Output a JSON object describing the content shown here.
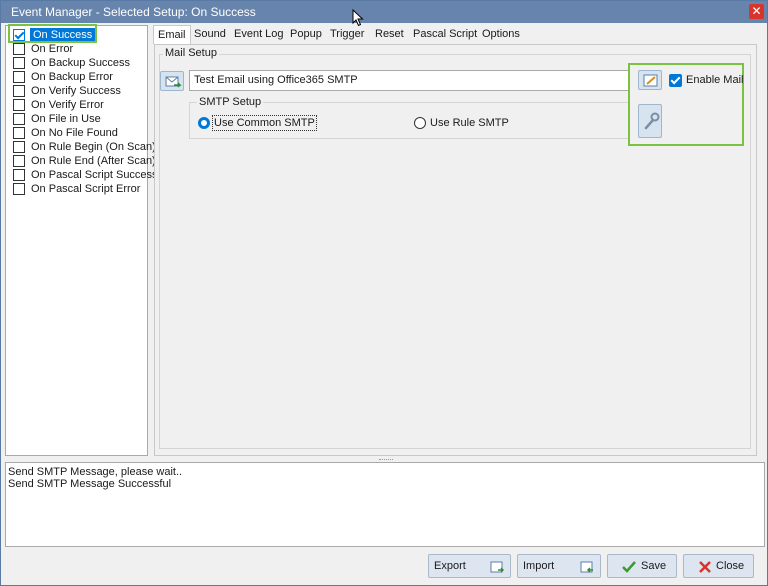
{
  "window": {
    "title": "Event Manager - Selected Setup: On Success",
    "close_glyph": "✕"
  },
  "events": [
    {
      "label": "On Success",
      "checked": true,
      "selected": true
    },
    {
      "label": "On Error",
      "checked": false
    },
    {
      "label": "On Backup Success",
      "checked": false
    },
    {
      "label": "On Backup Error",
      "checked": false
    },
    {
      "label": "On Verify Success",
      "checked": false
    },
    {
      "label": "On Verify Error",
      "checked": false
    },
    {
      "label": "On File in Use",
      "checked": false
    },
    {
      "label": "On No File Found",
      "checked": false
    },
    {
      "label": "On Rule Begin (On Scan)",
      "checked": false
    },
    {
      "label": "On Rule End (After Scan)",
      "checked": false
    },
    {
      "label": "On Pascal Script Success",
      "checked": false
    },
    {
      "label": "On Pascal Script Error",
      "checked": false
    }
  ],
  "tabs": [
    "Email",
    "Sound",
    "Event Log",
    "Popup",
    "Trigger",
    "Reset",
    "Pascal Script",
    "Options"
  ],
  "mail": {
    "group_label": "Mail Setup",
    "setup_value": "Test Email using Office365 SMTP",
    "smtp_group_label": "SMTP Setup",
    "use_common_smtp": "Use Common SMTP",
    "use_rule_smtp": "Use Rule SMTP",
    "enable_mail_label": "Enable Mail",
    "enable_mail_checked": true
  },
  "log": {
    "lines": [
      "Send SMTP Message, please wait..",
      "Send SMTP Message Successful"
    ]
  },
  "footer": {
    "export_label": "Export",
    "import_label": "Import",
    "save_label": "Save",
    "close_label": "Close"
  },
  "icons": {
    "mail_send": "mail-send-icon",
    "edit": "edit-icon",
    "tool": "wrench-icon",
    "save": "checkmark-icon",
    "close": "x-icon"
  },
  "colors": {
    "titlebar": "#6784ad",
    "selection": "#0078d7",
    "highlight": "#7cc242",
    "close_button": "#d9342b"
  }
}
